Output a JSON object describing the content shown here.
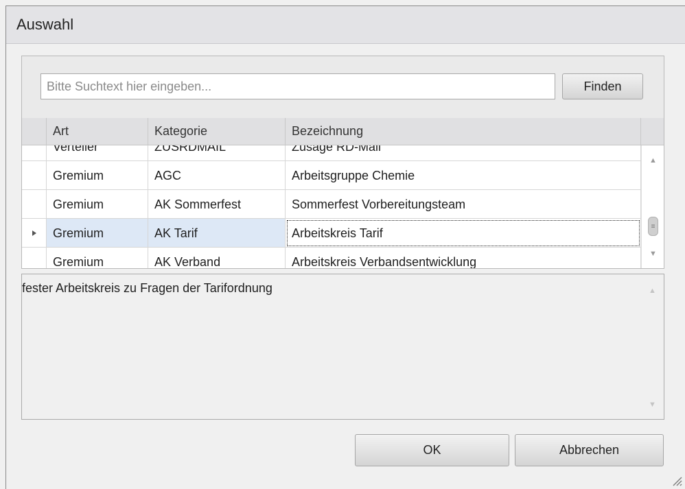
{
  "window": {
    "title": "Auswahl"
  },
  "search": {
    "placeholder": "Bitte Suchtext hier eingeben...",
    "value": "",
    "find_label": "Finden"
  },
  "grid": {
    "columns": [
      "Art",
      "Kategorie",
      "Bezeichnung"
    ],
    "rows": [
      {
        "art": "Verteiler",
        "kategorie": "ZUSRDMAIL",
        "bezeichnung": "Zusage RD-Mail"
      },
      {
        "art": "Gremium",
        "kategorie": "AGC",
        "bezeichnung": "Arbeitsgruppe Chemie"
      },
      {
        "art": "Gremium",
        "kategorie": "AK Sommerfest",
        "bezeichnung": "Sommerfest Vorbereitungsteam"
      },
      {
        "art": "Gremium",
        "kategorie": "AK Tarif",
        "bezeichnung": "Arbeitskreis Tarif",
        "selected": true
      },
      {
        "art": "Gremium",
        "kategorie": "AK Verband",
        "bezeichnung": "Arbeitskreis Verbandsentwicklung"
      }
    ]
  },
  "description": {
    "text": "fester Arbeitskreis zu Fragen der Tarifordnung"
  },
  "buttons": {
    "ok_label": "OK",
    "cancel_label": "Abbrechen"
  },
  "icons": {
    "row_indicator": "triangle-right-icon",
    "scroll_up": "chevron-up-icon",
    "scroll_down": "chevron-down-icon",
    "resize": "resize-grip-icon"
  },
  "colors": {
    "selected_row": "#dde8f6",
    "header_bg": "#e0e0e2",
    "titlebar_bg": "#e3e3e6"
  }
}
